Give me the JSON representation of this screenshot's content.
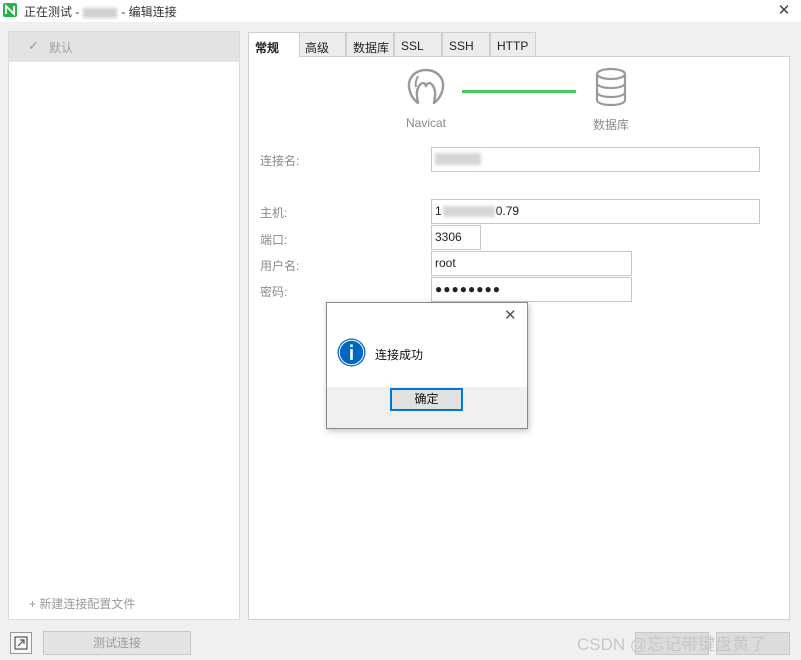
{
  "window": {
    "title_prefix": "正在测试 -",
    "title_suffix": "- 编辑连接",
    "close_glyph": "✕"
  },
  "sidebar": {
    "default_profile": {
      "check_glyph": "✓",
      "label": "默认"
    },
    "new_profile_label": "+ 新建连接配置文件"
  },
  "tabs": [
    "常规",
    "高级",
    "数据库",
    "SSL",
    "SSH",
    "HTTP"
  ],
  "diagram": {
    "left_label": "Navicat",
    "right_label": "数据库",
    "left_icon": "navicat-logo-icon",
    "right_icon": "database-icon",
    "line_color": "#44c95a"
  },
  "form": {
    "connection_name": {
      "label": "连接名:",
      "value": ""
    },
    "host": {
      "label": "主机:",
      "value_start": "1",
      "value_end": "0.79"
    },
    "port": {
      "label": "端口:",
      "value": "3306"
    },
    "username": {
      "label": "用户名:",
      "value": "root"
    },
    "password": {
      "label": "密码:",
      "value": "●●●●●●●●"
    }
  },
  "footer": {
    "test_button_label": "测试连接",
    "watermark": "CSDN @忘记带键盘黄了"
  },
  "dialog": {
    "close_glyph": "✕",
    "message": "连接成功",
    "ok_label": "确定",
    "icon": "info-icon",
    "accent": "#0078d7"
  }
}
